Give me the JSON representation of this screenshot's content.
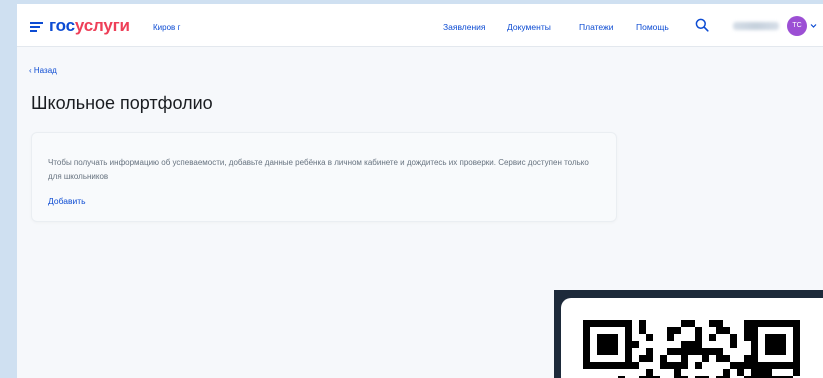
{
  "header": {
    "logo": {
      "part1": "гос",
      "part2": "услуги"
    },
    "city": "Киров г",
    "nav": [
      {
        "label": "Заявления"
      },
      {
        "label": "Документы"
      },
      {
        "label": "Платежи"
      },
      {
        "label": "Помощь"
      }
    ],
    "search_icon": "search-icon",
    "avatar_initials": "ТС",
    "colors": {
      "brand_blue": "#0d4cd3",
      "brand_red": "#ee3f58",
      "avatar": "#9c4fd4"
    }
  },
  "page": {
    "back_label": "‹ Назад",
    "title": "Школьное портфолио"
  },
  "card": {
    "text": "Чтобы получать информацию об успеваемости, добавьте данные ребёнка в личном кабинете и дождитесь их проверки. Сервис доступен только для школьников",
    "link": "Добавить"
  }
}
